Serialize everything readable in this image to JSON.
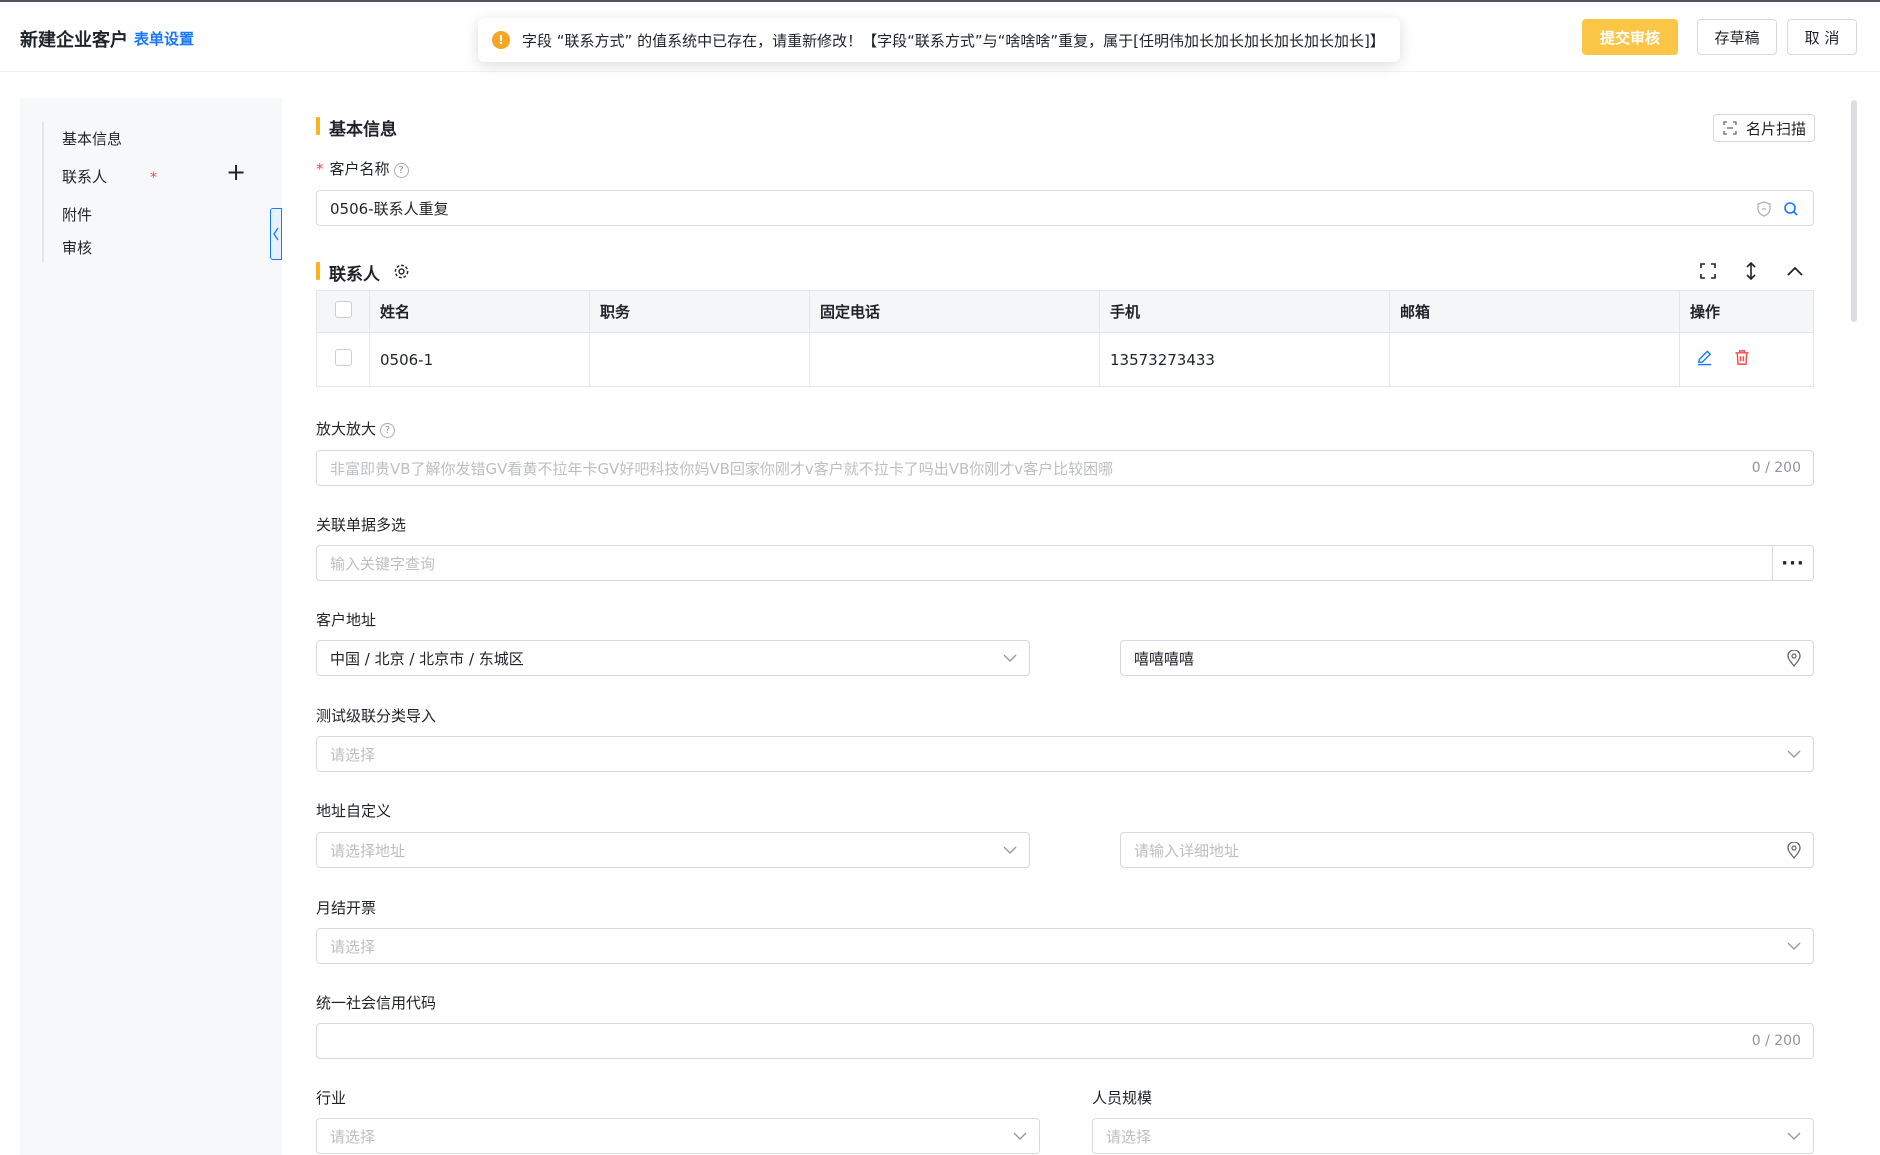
{
  "header": {
    "title": "新建企业客户",
    "form_settings": "表单设置",
    "submit": "提交审核",
    "draft": "存草稿",
    "cancel": "取 消"
  },
  "toast": {
    "icon": "warning-icon",
    "message": "字段 “联系方式” 的值系统中已存在，请重新修改！【字段“联系方式”与“啥啥啥”重复，属于[任明伟加长加长加长加长加长加长]】"
  },
  "nav": {
    "items": [
      "基本信息",
      "联系人",
      "附件",
      "审核"
    ],
    "required_mark": "*",
    "add": "+"
  },
  "basic": {
    "title": "基本信息",
    "scan": "名片扫描",
    "name_label": "客户名称",
    "name_value": "0506-联系人重复",
    "required_mark": "*"
  },
  "contacts": {
    "title": "联系人",
    "columns": [
      "姓名",
      "职务",
      "固定电话",
      "手机",
      "邮箱",
      "操作"
    ],
    "rows": [
      {
        "name": "0506-1",
        "position": "",
        "phone": "",
        "mobile": "13573273433",
        "email": ""
      }
    ]
  },
  "fields": {
    "zoom_label": "放大放大",
    "zoom_placeholder": "非富即贵VB了解你发错GV看黄不拉年卡GV好吧科技你妈VB回家你刚才v客户就不拉卡了吗出VB你刚才v客户比较困哪",
    "zoom_counter": "0 / 200",
    "related_label": "关联单据多选",
    "related_placeholder": "输入关键字查询",
    "related_more": "···",
    "address_label": "客户地址",
    "address_value": "中国 / 北京 / 北京市 / 东城区",
    "address_detail": "嘻嘻嘻嘻",
    "cascade_label": "测试级联分类导入",
    "cascade_placeholder": "请选择",
    "custom_addr_label": "地址自定义",
    "custom_addr_placeholder": "请选择地址",
    "custom_addr_detail_placeholder": "请输入详细地址",
    "invoice_label": "月结开票",
    "invoice_placeholder": "请选择",
    "credit_label": "统一社会信用代码",
    "credit_counter": "0 / 200",
    "industry_label": "行业",
    "industry_placeholder": "请选择",
    "staff_label": "人员规模",
    "staff_placeholder": "请选择"
  },
  "colors": {
    "accent": "#1677ff",
    "submit": "#fbc646",
    "section_bar": "#fbb321",
    "danger": "#f54a45"
  }
}
